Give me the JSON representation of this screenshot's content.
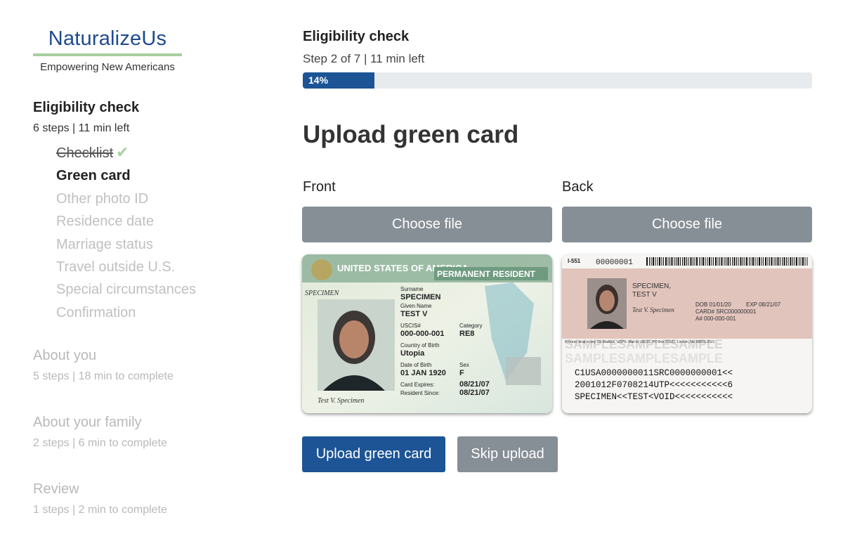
{
  "brand": {
    "name": "NaturalizeUs",
    "tagline": "Empowering New Americans"
  },
  "sidebar": {
    "current_section": {
      "title": "Eligibility check",
      "summary": "6 steps | 11 min left",
      "steps": [
        {
          "label": "Checklist",
          "state": "done"
        },
        {
          "label": "Green card",
          "state": "current"
        },
        {
          "label": "Other photo ID",
          "state": "pending"
        },
        {
          "label": "Residence date",
          "state": "pending"
        },
        {
          "label": "Marriage status",
          "state": "pending"
        },
        {
          "label": "Travel outside U.S.",
          "state": "pending"
        },
        {
          "label": "Special circumstances",
          "state": "pending"
        },
        {
          "label": "Confirmation",
          "state": "pending"
        }
      ]
    },
    "other_sections": [
      {
        "title": "About you",
        "summary": "5 steps | 18 min to complete"
      },
      {
        "title": "About your family",
        "summary": "2 steps | 6 min to complete"
      },
      {
        "title": "Review",
        "summary": "1 steps | 2 min to complete"
      }
    ],
    "check_glyph": "✔"
  },
  "main": {
    "section_title": "Eligibility check",
    "step_info": "Step 2 of 7 | 11 min left",
    "progress": {
      "percent": 14,
      "label": "14%"
    },
    "page_title": "Upload green card",
    "front": {
      "label": "Front",
      "button": "Choose file",
      "card": {
        "banner_left": "UNITED STATES OF AMERICA",
        "banner_right": "PERMANENT RESIDENT",
        "surname_label": "Surname",
        "surname": "SPECIMEN",
        "given_label": "Given Name",
        "given": "TEST V",
        "uscis_label": "USCIS#",
        "uscis": "000-000-001",
        "category_label": "Category",
        "category": "RE8",
        "country_label": "Country of Birth",
        "country": "Utopia",
        "dob_label": "Date of Birth",
        "dob": "01 JAN 1920",
        "sex_label": "Sex",
        "sex": "F",
        "expires_label": "Card Expires:",
        "expires": "08/21/07",
        "since_label": "Resident Since:",
        "since": "08/21/07",
        "watermark": "SPECIMEN",
        "signature": "Test V. Specimen"
      }
    },
    "back": {
      "label": "Back",
      "button": "Choose file",
      "card": {
        "form_no": "I-551",
        "serial": "00000001",
        "name1": "SPECIMEN,",
        "name2": "TEST V",
        "dob": "DOB 01/01/20",
        "exp": "EXP 08/21/07",
        "card_no": "CARD# SRC000000001",
        "a_no": "A# 000-000-001",
        "signature": "Test V. Specimen",
        "watermark": "SAMPLESAMPLESAMPLE",
        "notice": "If found, drop in any US Mailbox. USPS: Mail to USCIS, PO Box 82521, Lincoln, NE 68501-2521",
        "mrz": [
          "C1USA0000000011SRC0000000001<<",
          "2001012F0708214UTP<<<<<<<<<<<6",
          "SPECIMEN<<TEST<VOID<<<<<<<<<<<"
        ]
      }
    },
    "actions": {
      "upload": "Upload green card",
      "skip": "Skip upload"
    }
  },
  "colors": {
    "brand_blue": "#1f4a8c",
    "primary": "#1c5496",
    "secondary": "#868e96",
    "check_green": "#a8d4a0",
    "muted_text": "#b9b9b9"
  }
}
